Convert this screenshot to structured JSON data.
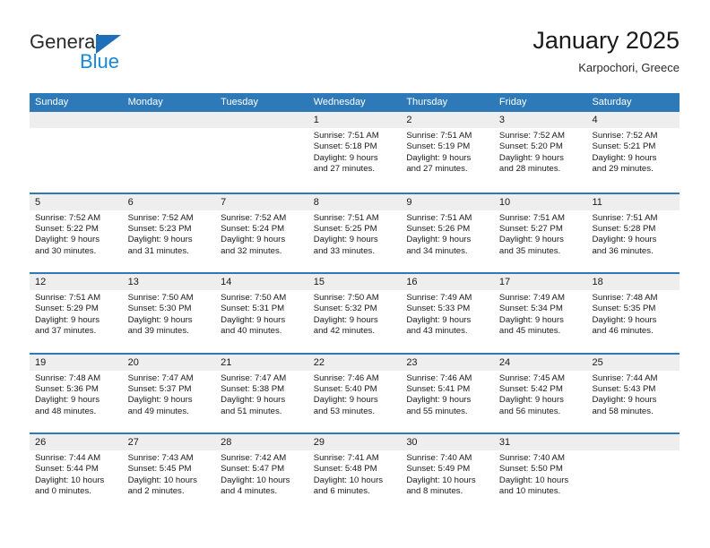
{
  "brand": {
    "line1": "General",
    "line2": "Blue",
    "triangle_color": "#1e6fb8"
  },
  "header": {
    "title": "January 2025",
    "subtitle": "Karpochori, Greece"
  },
  "theme": {
    "header_blue": "#2e7ab8",
    "band_gray": "#eeeeee",
    "text": "#1a1a1a"
  },
  "weekdays": [
    "Sunday",
    "Monday",
    "Tuesday",
    "Wednesday",
    "Thursday",
    "Friday",
    "Saturday"
  ],
  "weeks": [
    [
      {
        "empty": true,
        "day": "",
        "sunrise": "",
        "sunset": "",
        "daylight_1": "",
        "daylight_2": ""
      },
      {
        "empty": true,
        "day": "",
        "sunrise": "",
        "sunset": "",
        "daylight_1": "",
        "daylight_2": ""
      },
      {
        "empty": true,
        "day": "",
        "sunrise": "",
        "sunset": "",
        "daylight_1": "",
        "daylight_2": ""
      },
      {
        "empty": false,
        "day": "1",
        "sunrise": "Sunrise: 7:51 AM",
        "sunset": "Sunset: 5:18 PM",
        "daylight_1": "Daylight: 9 hours",
        "daylight_2": "and 27 minutes."
      },
      {
        "empty": false,
        "day": "2",
        "sunrise": "Sunrise: 7:51 AM",
        "sunset": "Sunset: 5:19 PM",
        "daylight_1": "Daylight: 9 hours",
        "daylight_2": "and 27 minutes."
      },
      {
        "empty": false,
        "day": "3",
        "sunrise": "Sunrise: 7:52 AM",
        "sunset": "Sunset: 5:20 PM",
        "daylight_1": "Daylight: 9 hours",
        "daylight_2": "and 28 minutes."
      },
      {
        "empty": false,
        "day": "4",
        "sunrise": "Sunrise: 7:52 AM",
        "sunset": "Sunset: 5:21 PM",
        "daylight_1": "Daylight: 9 hours",
        "daylight_2": "and 29 minutes."
      }
    ],
    [
      {
        "empty": false,
        "day": "5",
        "sunrise": "Sunrise: 7:52 AM",
        "sunset": "Sunset: 5:22 PM",
        "daylight_1": "Daylight: 9 hours",
        "daylight_2": "and 30 minutes."
      },
      {
        "empty": false,
        "day": "6",
        "sunrise": "Sunrise: 7:52 AM",
        "sunset": "Sunset: 5:23 PM",
        "daylight_1": "Daylight: 9 hours",
        "daylight_2": "and 31 minutes."
      },
      {
        "empty": false,
        "day": "7",
        "sunrise": "Sunrise: 7:52 AM",
        "sunset": "Sunset: 5:24 PM",
        "daylight_1": "Daylight: 9 hours",
        "daylight_2": "and 32 minutes."
      },
      {
        "empty": false,
        "day": "8",
        "sunrise": "Sunrise: 7:51 AM",
        "sunset": "Sunset: 5:25 PM",
        "daylight_1": "Daylight: 9 hours",
        "daylight_2": "and 33 minutes."
      },
      {
        "empty": false,
        "day": "9",
        "sunrise": "Sunrise: 7:51 AM",
        "sunset": "Sunset: 5:26 PM",
        "daylight_1": "Daylight: 9 hours",
        "daylight_2": "and 34 minutes."
      },
      {
        "empty": false,
        "day": "10",
        "sunrise": "Sunrise: 7:51 AM",
        "sunset": "Sunset: 5:27 PM",
        "daylight_1": "Daylight: 9 hours",
        "daylight_2": "and 35 minutes."
      },
      {
        "empty": false,
        "day": "11",
        "sunrise": "Sunrise: 7:51 AM",
        "sunset": "Sunset: 5:28 PM",
        "daylight_1": "Daylight: 9 hours",
        "daylight_2": "and 36 minutes."
      }
    ],
    [
      {
        "empty": false,
        "day": "12",
        "sunrise": "Sunrise: 7:51 AM",
        "sunset": "Sunset: 5:29 PM",
        "daylight_1": "Daylight: 9 hours",
        "daylight_2": "and 37 minutes."
      },
      {
        "empty": false,
        "day": "13",
        "sunrise": "Sunrise: 7:50 AM",
        "sunset": "Sunset: 5:30 PM",
        "daylight_1": "Daylight: 9 hours",
        "daylight_2": "and 39 minutes."
      },
      {
        "empty": false,
        "day": "14",
        "sunrise": "Sunrise: 7:50 AM",
        "sunset": "Sunset: 5:31 PM",
        "daylight_1": "Daylight: 9 hours",
        "daylight_2": "and 40 minutes."
      },
      {
        "empty": false,
        "day": "15",
        "sunrise": "Sunrise: 7:50 AM",
        "sunset": "Sunset: 5:32 PM",
        "daylight_1": "Daylight: 9 hours",
        "daylight_2": "and 42 minutes."
      },
      {
        "empty": false,
        "day": "16",
        "sunrise": "Sunrise: 7:49 AM",
        "sunset": "Sunset: 5:33 PM",
        "daylight_1": "Daylight: 9 hours",
        "daylight_2": "and 43 minutes."
      },
      {
        "empty": false,
        "day": "17",
        "sunrise": "Sunrise: 7:49 AM",
        "sunset": "Sunset: 5:34 PM",
        "daylight_1": "Daylight: 9 hours",
        "daylight_2": "and 45 minutes."
      },
      {
        "empty": false,
        "day": "18",
        "sunrise": "Sunrise: 7:48 AM",
        "sunset": "Sunset: 5:35 PM",
        "daylight_1": "Daylight: 9 hours",
        "daylight_2": "and 46 minutes."
      }
    ],
    [
      {
        "empty": false,
        "day": "19",
        "sunrise": "Sunrise: 7:48 AM",
        "sunset": "Sunset: 5:36 PM",
        "daylight_1": "Daylight: 9 hours",
        "daylight_2": "and 48 minutes."
      },
      {
        "empty": false,
        "day": "20",
        "sunrise": "Sunrise: 7:47 AM",
        "sunset": "Sunset: 5:37 PM",
        "daylight_1": "Daylight: 9 hours",
        "daylight_2": "and 49 minutes."
      },
      {
        "empty": false,
        "day": "21",
        "sunrise": "Sunrise: 7:47 AM",
        "sunset": "Sunset: 5:38 PM",
        "daylight_1": "Daylight: 9 hours",
        "daylight_2": "and 51 minutes."
      },
      {
        "empty": false,
        "day": "22",
        "sunrise": "Sunrise: 7:46 AM",
        "sunset": "Sunset: 5:40 PM",
        "daylight_1": "Daylight: 9 hours",
        "daylight_2": "and 53 minutes."
      },
      {
        "empty": false,
        "day": "23",
        "sunrise": "Sunrise: 7:46 AM",
        "sunset": "Sunset: 5:41 PM",
        "daylight_1": "Daylight: 9 hours",
        "daylight_2": "and 55 minutes."
      },
      {
        "empty": false,
        "day": "24",
        "sunrise": "Sunrise: 7:45 AM",
        "sunset": "Sunset: 5:42 PM",
        "daylight_1": "Daylight: 9 hours",
        "daylight_2": "and 56 minutes."
      },
      {
        "empty": false,
        "day": "25",
        "sunrise": "Sunrise: 7:44 AM",
        "sunset": "Sunset: 5:43 PM",
        "daylight_1": "Daylight: 9 hours",
        "daylight_2": "and 58 minutes."
      }
    ],
    [
      {
        "empty": false,
        "day": "26",
        "sunrise": "Sunrise: 7:44 AM",
        "sunset": "Sunset: 5:44 PM",
        "daylight_1": "Daylight: 10 hours",
        "daylight_2": "and 0 minutes."
      },
      {
        "empty": false,
        "day": "27",
        "sunrise": "Sunrise: 7:43 AM",
        "sunset": "Sunset: 5:45 PM",
        "daylight_1": "Daylight: 10 hours",
        "daylight_2": "and 2 minutes."
      },
      {
        "empty": false,
        "day": "28",
        "sunrise": "Sunrise: 7:42 AM",
        "sunset": "Sunset: 5:47 PM",
        "daylight_1": "Daylight: 10 hours",
        "daylight_2": "and 4 minutes."
      },
      {
        "empty": false,
        "day": "29",
        "sunrise": "Sunrise: 7:41 AM",
        "sunset": "Sunset: 5:48 PM",
        "daylight_1": "Daylight: 10 hours",
        "daylight_2": "and 6 minutes."
      },
      {
        "empty": false,
        "day": "30",
        "sunrise": "Sunrise: 7:40 AM",
        "sunset": "Sunset: 5:49 PM",
        "daylight_1": "Daylight: 10 hours",
        "daylight_2": "and 8 minutes."
      },
      {
        "empty": false,
        "day": "31",
        "sunrise": "Sunrise: 7:40 AM",
        "sunset": "Sunset: 5:50 PM",
        "daylight_1": "Daylight: 10 hours",
        "daylight_2": "and 10 minutes."
      },
      {
        "empty": true,
        "day": "",
        "sunrise": "",
        "sunset": "",
        "daylight_1": "",
        "daylight_2": ""
      }
    ]
  ]
}
